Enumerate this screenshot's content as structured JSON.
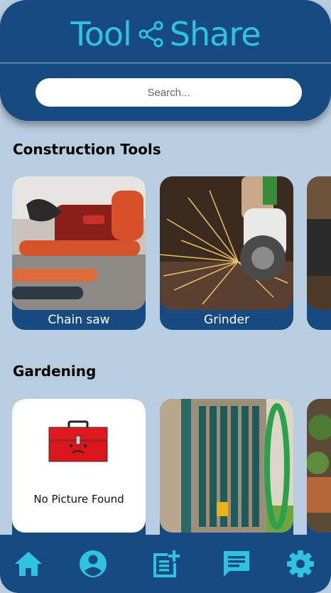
{
  "app": {
    "title_left": "Tool",
    "title_right": "Share",
    "accent_color": "#2ec3e2",
    "primary_color": "#174a80",
    "background_color": "#b9cde1"
  },
  "search": {
    "placeholder": "Search..."
  },
  "sections": [
    {
      "title": "Construction Tools",
      "items": [
        {
          "label": "Chain saw",
          "image": "chain-saw-photo"
        },
        {
          "label": "Grinder",
          "image": "grinder-photo"
        },
        {
          "label": "",
          "image": "partial-tool-photo"
        }
      ]
    },
    {
      "title": "Gardening",
      "items": [
        {
          "label": "",
          "image": "no-picture-toolbox",
          "placeholder_text": "No Picture Found"
        },
        {
          "label": "",
          "image": "garden-hose-reel-photo"
        },
        {
          "label": "",
          "image": "partial-plant-photo"
        }
      ]
    }
  ],
  "nav": [
    {
      "name": "home",
      "icon": "home-icon"
    },
    {
      "name": "profile",
      "icon": "account-circle-icon"
    },
    {
      "name": "add-listing",
      "icon": "post-add-icon"
    },
    {
      "name": "messages",
      "icon": "chat-icon"
    },
    {
      "name": "settings",
      "icon": "gear-icon"
    }
  ]
}
